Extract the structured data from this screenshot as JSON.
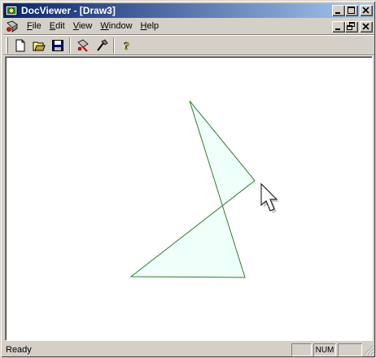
{
  "window": {
    "title": "DocViewer - [Draw3]"
  },
  "menu": {
    "items": [
      {
        "label": "File",
        "accel": "F",
        "rest": "ile"
      },
      {
        "label": "Edit",
        "accel": "E",
        "rest": "dit"
      },
      {
        "label": "View",
        "accel": "V",
        "rest": "iew"
      },
      {
        "label": "Window",
        "accel": "W",
        "rest": "indow"
      },
      {
        "label": "Help",
        "accel": "H",
        "rest": "elp"
      }
    ]
  },
  "toolbar": {
    "buttons": [
      "new-document-icon",
      "open-folder-icon",
      "save-disk-icon",
      "draw-tool-icon",
      "edit-tool-icon",
      "help-question-icon"
    ]
  },
  "canvas": {
    "shape_fill": "#effffa",
    "shape_stroke": "#2f7a2f"
  },
  "status": {
    "text": "Ready",
    "pane_num": "NUM"
  }
}
